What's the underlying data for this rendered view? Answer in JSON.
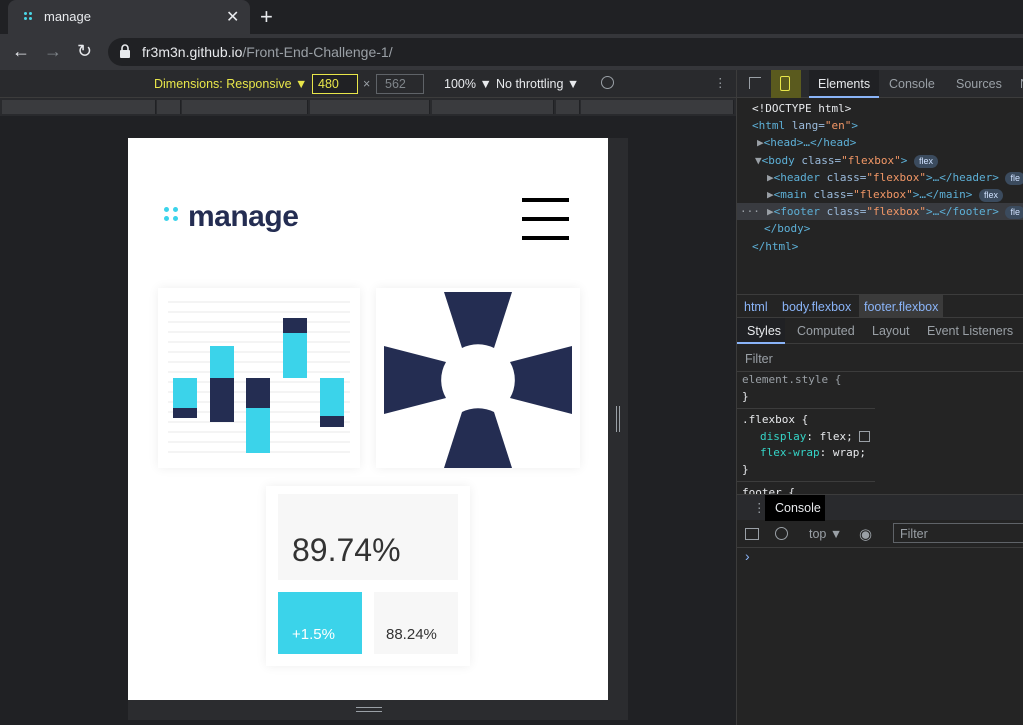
{
  "browser": {
    "tab_title": "manage",
    "tab_close": "✕",
    "new_tab": "+",
    "url_host": "fr3m3n.github.io",
    "url_path": "/Front-End-Challenge-1/"
  },
  "device_toolbar": {
    "dimensions_label": "Dimensions: Responsive ▼",
    "width": "480",
    "times": "×",
    "height": "562",
    "zoom": "100% ▼",
    "throttling": "No throttling ▼",
    "more": "⋮"
  },
  "site": {
    "logo_text": "manage",
    "stats": {
      "main": "89.74%",
      "up": "+1.5%",
      "second": "88.24%"
    },
    "accent_color": "#3bd3ea",
    "dark_color": "#242d52"
  },
  "devtools": {
    "tabs": [
      "Elements",
      "Console",
      "Sources",
      "N"
    ],
    "dom": {
      "doctype": "<!DOCTYPE html>",
      "html_open": "<html ",
      "html_attr": "lang=",
      "html_val": "\"en\"",
      "html_close": ">",
      "head": "<head>…</head>",
      "body_open": "<body ",
      "body_attr": "class=",
      "body_val": "\"flexbox\"",
      "header_open": "<header ",
      "header_close": ">…</header>",
      "main_open": "<main ",
      "main_close": ">…</main>",
      "footer_open": "<footer ",
      "footer_close": ">…</footer>",
      "class_attr": "class=",
      "flex_val": "\"flexbox\"",
      "body_end": "</body>",
      "html_end": "</html>",
      "badge": "flex",
      "badge_cut": "fle"
    },
    "breadcrumbs": [
      "html",
      "body.flexbox",
      "footer.flexbox"
    ],
    "style_tabs": [
      "Styles",
      "Computed",
      "Layout",
      "Event Listeners"
    ],
    "filter_placeholder": "Filter",
    "rules": {
      "element_style": "element.style {",
      "close": "}",
      "selector": ".flexbox {",
      "p1": "display",
      "v1": "flex;",
      "p2": "flex-wrap",
      "v2": "wrap;",
      "footer": "footer {"
    },
    "console_label": "Console",
    "console_context": "top ▼",
    "console_filter": "Filter",
    "prompt": "›"
  }
}
